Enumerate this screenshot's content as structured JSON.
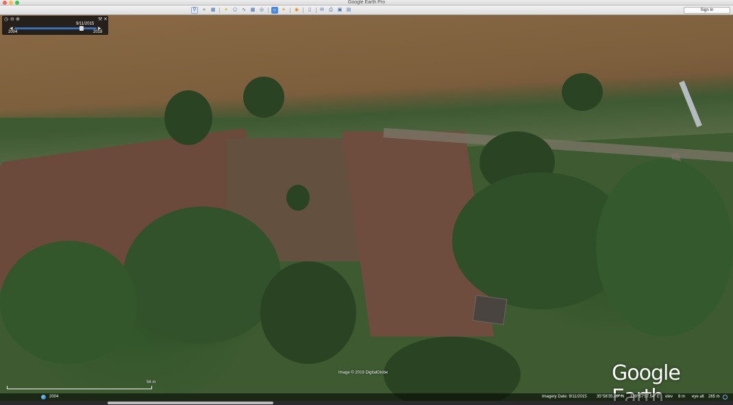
{
  "window": {
    "title": "Google Earth Pro"
  },
  "toolbar": {
    "icons": [
      "search-icon",
      "placemark-icon",
      "sidebar-icon",
      "placemark-add-icon",
      "polygon-icon",
      "path-icon",
      "overlay-icon",
      "tour-icon",
      "sky-icon",
      "sun-icon",
      "planet-icon",
      "ruler-icon",
      "email-icon",
      "print-icon",
      "maps-icon",
      "save-image-icon"
    ],
    "sign_in_label": "Sign In",
    "accent_color": "#4a8ad9"
  },
  "time_slider": {
    "current_date": "9/11/2015",
    "start_year": "2004",
    "end_year": "2018",
    "position_fraction": 0.82
  },
  "map": {
    "copyright": "Image © 2019 DigitalGlobe",
    "logo_text": "Google Earth",
    "scale_label": "56 m"
  },
  "status": {
    "history_year": "2004",
    "imagery_date": "Imagery Date: 9/11/2015",
    "latitude": "35°58'35.10\" N",
    "longitude": "139°57'57.54\" E",
    "elev_label": "elev",
    "elev_value": "8 m",
    "eye_alt_label": "eye alt",
    "eye_alt_value": "265 m"
  }
}
